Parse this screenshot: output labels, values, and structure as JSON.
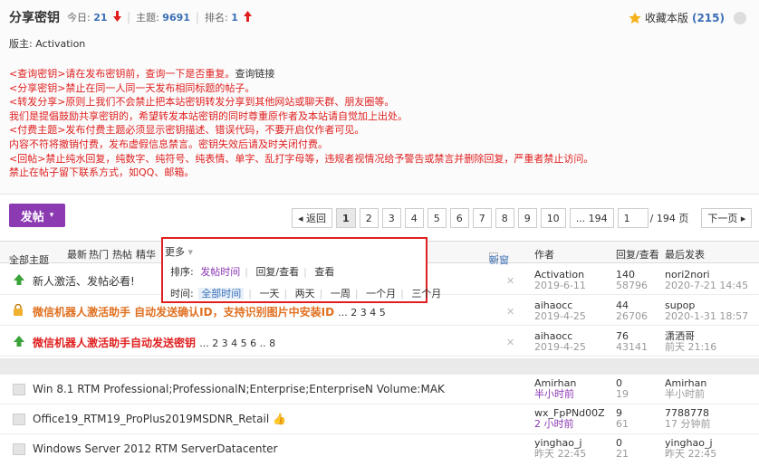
{
  "header": {
    "forum_title": "分享密钥",
    "today_label": "今日:",
    "today_count": "21",
    "threads_label": "主题:",
    "threads_count": "9691",
    "rank_label": "排名:",
    "rank_value": "1",
    "moderator": "版主: Activation",
    "favorite_label": "收藏本版",
    "favorite_count": "(215)"
  },
  "rules": [
    {
      "text": "<查询密钥>请在发布密钥前，查询一下是否重复。",
      "link": "查询链接"
    },
    {
      "text": "<分享密钥>禁止在同一人同一天发布相同标题的帖子。"
    },
    {
      "text": "<转发分享>原则上我们不会禁止把本站密钥转发分享到其他网站或聊天群、朋友圈等。"
    },
    {
      "text": "我们是提倡鼓励共享密钥的，希望转发本站密钥的同时尊重原作者及本站请自觉加上出处。"
    },
    {
      "text": "<付费主题>发布付费主题必须显示密钥描述、错误代码，不要开启仅作者可见。"
    },
    {
      "text": "内容不符将撤销付费，发布虚假信息禁言。密钥失效后请及时关闭付费。"
    },
    {
      "text": "<回帖>禁止纯水回复，纯数字、纯符号、纯表情、单字、乱打字母等，违规者视情况给予警告或禁言并删除回复，严重者禁止访问。"
    },
    {
      "text": "禁止在帖子留下联系方式，如QQ、邮箱。"
    }
  ],
  "toolbar": {
    "post_label": "发帖",
    "back_label": "◂ 返回",
    "pages": [
      "1",
      "2",
      "3",
      "4",
      "5",
      "6",
      "7",
      "8",
      "9",
      "10",
      "... 194"
    ],
    "page_input": "1",
    "total_pages": "/ 194 页",
    "next_label": "下一页 ▸"
  },
  "table_header": {
    "filters": [
      "全部主题",
      "最新",
      "热门",
      "热帖",
      "精华",
      "更多"
    ],
    "new_window": "新窗",
    "author": "作者",
    "replies_views": "回复/查看",
    "last_post": "最后发表"
  },
  "dropdown": {
    "sort_label": "排序:",
    "sort_options": [
      "发帖时间",
      "回复/查看",
      "查看"
    ],
    "time_label": "时间:",
    "time_options": [
      "全部时间",
      "一天",
      "两天",
      "一周",
      "一个月",
      "三个月"
    ]
  },
  "threads": [
    {
      "title": "新人激活、发帖必看!",
      "author": "Activation",
      "date": "2019-6-11",
      "replies": "140",
      "views": "58796",
      "last_user": "nori2nori",
      "last_time": "2020-7-21 14:45"
    },
    {
      "title": "微信机器人激活助手 自动发送确认ID，支持识别图片中安装ID",
      "pages": "... 2 3 4 5",
      "author": "aihaocc",
      "date": "2019-4-25",
      "replies": "44",
      "views": "26706",
      "last_user": "supop",
      "last_time": "2020-1-31 18:57"
    },
    {
      "title": "微信机器人激活助手自动发送密钥",
      "pages": "... 2 3 4 5 6 .. 8",
      "author": "aihaocc",
      "date": "2019-4-25",
      "replies": "76",
      "views": "43141",
      "last_user": "潇洒哥",
      "last_time": "前天 21:16"
    },
    {
      "title": "Win 8.1 RTM Professional;ProfessionalN;Enterprise;EnterpriseN Volume:MAK",
      "author": "Amirhan",
      "date": "半小时前",
      "replies": "0",
      "views": "19",
      "last_user": "Amirhan",
      "last_time": "半小时前"
    },
    {
      "title": "Office19_RTM19_ProPlus2019MSDNR_Retail",
      "author": "wx_FpPNd00Z",
      "date": "2 小时前",
      "replies": "9",
      "views": "61",
      "last_user": "7788778",
      "last_time": "17 分钟前"
    },
    {
      "title": "Windows Server 2012 RTM ServerDatacenter",
      "author": "yinghao_j",
      "date": "昨天 22:45",
      "replies": "0",
      "views": "21",
      "last_user": "yinghao_j",
      "last_time": "昨天 22:45"
    }
  ],
  "colors": {
    "accent": "#8c3ab2",
    "link_blue": "#3a6fb5",
    "rule_red": "#e02020",
    "highlight_orange": "#e07020"
  }
}
